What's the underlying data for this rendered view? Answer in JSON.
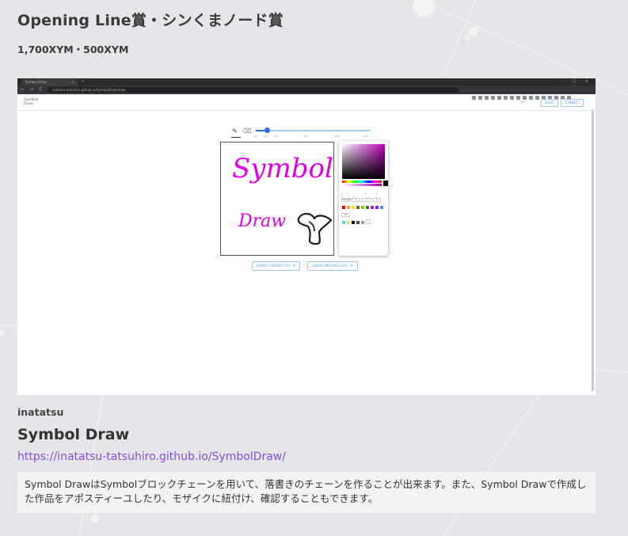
{
  "award": {
    "title": "Opening Line賞・シンくまノード賞",
    "prize": "1,700XYM・500XYM"
  },
  "screenshot": {
    "browser": {
      "tab_title": "Symbol Draw",
      "tab_close": "×",
      "new_tab": "+",
      "window_controls": "– ▢ ×",
      "nav_icons": "← → C ⌂",
      "address": "inatatsu-tatsuhiro.github.io/SymbolDraw/draw"
    },
    "app": {
      "logo": "SymBoll Draw",
      "arrow": "⟵",
      "button_1": "AUDIT",
      "button_2": "CONNECT",
      "tool_pen": "✎",
      "tool_eraser": "⌫",
      "slider_value": 0.1,
      "slider_ticks": [
        "1px",
        "3px",
        "5px",
        "10px",
        "15px",
        "20px"
      ],
      "canvas_text_1": "Symbol",
      "canvas_text_2": "Draw",
      "picker": {
        "hex": "#000000",
        "fields": [
          "#000000",
          "0",
          "0",
          "0",
          "100"
        ],
        "labels": "Hex R G B A",
        "swatches": [
          "#d0021b",
          "#f5a623",
          "#f8e71c",
          "#8b572a",
          "#7ed321",
          "#417505",
          "#bd10e0",
          "#9013fe",
          "#4a90e2",
          "#50e3c2",
          "#b8e986",
          "#000000",
          "#4a4a4a",
          "#9b9b9b",
          "#ffffff"
        ]
      },
      "share_current": "SHARE CURRENT ART",
      "share_previous": "SHARE PREVIOUS ART",
      "plane_icon": "✈"
    }
  },
  "author": "inatatsu",
  "work": {
    "title": "Symbol Draw",
    "url": "https://inatatsu-tatsuhiro.github.io/SymbolDraw/",
    "description": "Symbol DrawはSymbolブロックチェーンを用いて、落書きのチェーンを作ることが出来ます。また、Symbol Drawで作成した作品をアポスティーユしたり、モザイクに紐付け、確認することもできます。"
  }
}
